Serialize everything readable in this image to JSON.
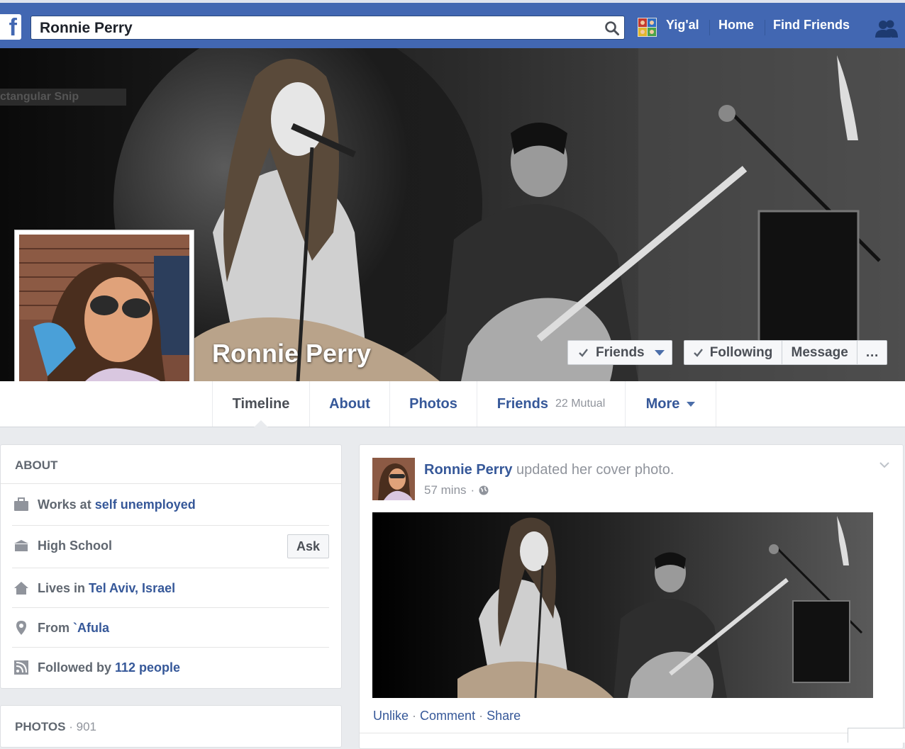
{
  "topbar": {
    "search_value": "Ronnie Perry",
    "user_name": "Yig'al",
    "home_label": "Home",
    "find_friends_label": "Find Friends",
    "logo_letter": "f",
    "brand_color": "#4267b2"
  },
  "cover": {
    "snip_label": "ctangular Snip",
    "profile_name": "Ronnie Perry",
    "friends_button": "Friends",
    "following_button": "Following",
    "message_button": "Message",
    "more_button": "…"
  },
  "tabs": [
    {
      "label": "Timeline"
    },
    {
      "label": "About"
    },
    {
      "label": "Photos"
    },
    {
      "label": "Friends",
      "count": "22 Mutual"
    },
    {
      "label": "More"
    }
  ],
  "about": {
    "heading": "ABOUT",
    "work_prefix": "Works at",
    "work_link": "self unemployed",
    "school": "High School",
    "ask_label": "Ask",
    "lives_prefix": "Lives in",
    "lives_link": "Tel Aviv, Israel",
    "from_prefix": "From",
    "from_link": "`Afula",
    "followed_prefix": "Followed by",
    "followed_link": "112 people"
  },
  "photos": {
    "heading": "PHOTOS",
    "count": "901"
  },
  "post": {
    "author": "Ronnie Perry",
    "action": "updated her cover photo.",
    "time": "57 mins",
    "actions": {
      "unlike": "Unlike",
      "comment": "Comment",
      "share": "Share"
    }
  }
}
